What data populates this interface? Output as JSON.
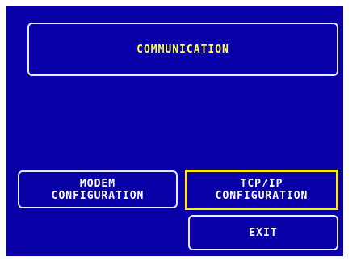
{
  "header": {
    "title": "COMMUNICATION"
  },
  "buttons": {
    "modem_label": "MODEM\nCONFIGURATION",
    "tcpip_label": "TCP/IP\nCONFIGURATION",
    "exit_label": "EXIT"
  },
  "colors": {
    "screen_background": "#0a00a8",
    "title_text": "#ffff55",
    "selection_border": "#ffe71a"
  }
}
